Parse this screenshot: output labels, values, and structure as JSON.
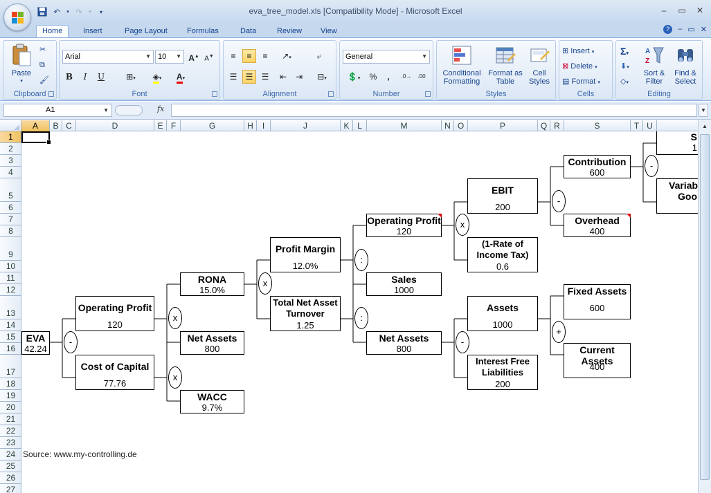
{
  "window": {
    "title": "eva_tree_model.xls  [Compatibility Mode] - Microsoft Excel",
    "controls": [
      "–",
      "▭",
      "✕"
    ]
  },
  "ribbon_tabs": [
    "Home",
    "Insert",
    "Page Layout",
    "Formulas",
    "Data",
    "Review",
    "View"
  ],
  "ribbon": {
    "clipboard": {
      "paste": "Paste",
      "label": "Clipboard"
    },
    "font": {
      "name": "Arial",
      "size": "10",
      "label": "Font",
      "bold": "B",
      "italic": "I",
      "underline": "U"
    },
    "alignment": {
      "label": "Alignment"
    },
    "number": {
      "format": "General",
      "label": "Number",
      "percent": "%",
      "comma": ","
    },
    "styles": {
      "conditional": "Conditional Formatting",
      "format_table": "Format as Table",
      "cell_styles": "Cell Styles",
      "label": "Styles"
    },
    "cells": {
      "insert": "Insert",
      "delete": "Delete",
      "format": "Format",
      "label": "Cells"
    },
    "editing": {
      "sum": "Σ",
      "sort": "Sort & Filter",
      "find": "Find & Select",
      "label": "Editing"
    }
  },
  "formula_bar": {
    "name_box": "A1",
    "fx": "fx",
    "formula": ""
  },
  "columns": [
    "A",
    "B",
    "C",
    "D",
    "E",
    "F",
    "G",
    "H",
    "I",
    "J",
    "K",
    "L",
    "M",
    "N",
    "O",
    "P",
    "Q",
    "R",
    "S",
    "T",
    "U"
  ],
  "rows": [
    "1",
    "2",
    "3",
    "4",
    "5",
    "6",
    "7",
    "8",
    "9",
    "10",
    "11",
    "12",
    "13",
    "14",
    "15",
    "16",
    "17",
    "18",
    "19",
    "20",
    "21",
    "22",
    "23",
    "24",
    "25",
    "26",
    "27"
  ],
  "selected_cell": "A1",
  "tree": {
    "eva": {
      "label": "EVA",
      "value": "42.24"
    },
    "op_profit_1": {
      "label": "Operating Profit",
      "value": "120"
    },
    "cost_capital": {
      "label": "Cost of Capital",
      "value": "77.76"
    },
    "rona": {
      "label": "RONA",
      "value": "15.0%"
    },
    "net_assets_1": {
      "label": "Net Assets",
      "value": "800"
    },
    "wacc": {
      "label": "WACC",
      "value": "9.7%"
    },
    "profit_margin": {
      "label": "Profit Margin",
      "value": "12.0%"
    },
    "turnover": {
      "label": "Total Net Asset Turnover",
      "value": "1.25"
    },
    "op_profit_2": {
      "label": "Operating Profit",
      "value": "120"
    },
    "sales": {
      "label": "Sales",
      "value": "1000"
    },
    "net_assets_2": {
      "label": "Net Assets",
      "value": "800"
    },
    "ebit": {
      "label": "EBIT",
      "value": "200"
    },
    "tax": {
      "label": "(1-Rate of Income Tax)",
      "value": "0.6"
    },
    "assets": {
      "label": "Assets",
      "value": "1000"
    },
    "ifl": {
      "label": "Interest Free Liabilities",
      "value": "200"
    },
    "contribution": {
      "label": "Contribution",
      "value": "600"
    },
    "overhead": {
      "label": "Overhead",
      "value": "400"
    },
    "fixed_assets": {
      "label": "Fixed Assets",
      "value": "600"
    },
    "current_assets": {
      "label": "Current Assets",
      "value": "400"
    },
    "sales_cut": {
      "label": "S",
      "value": "1"
    },
    "variable_cut": {
      "label": "Variab",
      "value": "Goo"
    }
  },
  "operators": {
    "eva": "-",
    "op1": "x",
    "cost": "x",
    "rona": "x",
    "pm": ":",
    "tnat": ":",
    "op2": "x",
    "na": "-",
    "ebit": "-",
    "assets": "+",
    "contrib": "-"
  },
  "source": "Source: www.my-controlling.de"
}
